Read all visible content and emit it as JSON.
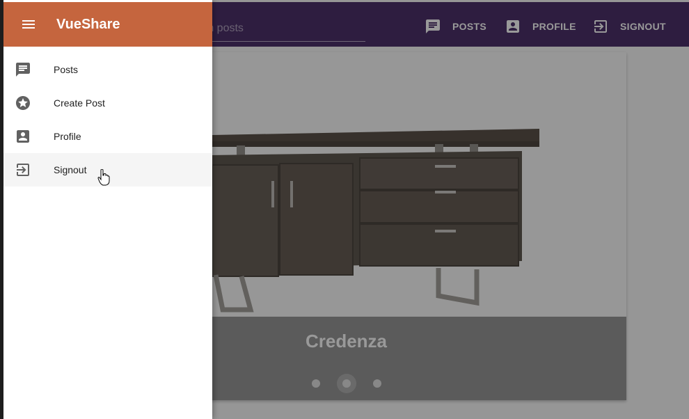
{
  "app": {
    "brand": "VueShare"
  },
  "toolbar": {
    "search_placeholder": "Search posts",
    "search_visible_text": "rch posts",
    "nav": [
      {
        "label": "POSTS",
        "icon": "posts-icon"
      },
      {
        "label": "PROFILE",
        "icon": "profile-icon"
      },
      {
        "label": "SIGNOUT",
        "icon": "signout-icon"
      }
    ]
  },
  "drawer": {
    "items": [
      {
        "label": "Posts",
        "icon": "posts-icon"
      },
      {
        "label": "Create Post",
        "icon": "star-icon"
      },
      {
        "label": "Profile",
        "icon": "profile-icon"
      },
      {
        "label": "Signout",
        "icon": "signout-icon"
      }
    ],
    "active_index": 3
  },
  "carousel": {
    "caption": "Credenza",
    "slide_count": 3,
    "active_slide": 2
  },
  "colors": {
    "toolbar": "#3a1a5c",
    "drawer_header": "#c5653e"
  }
}
